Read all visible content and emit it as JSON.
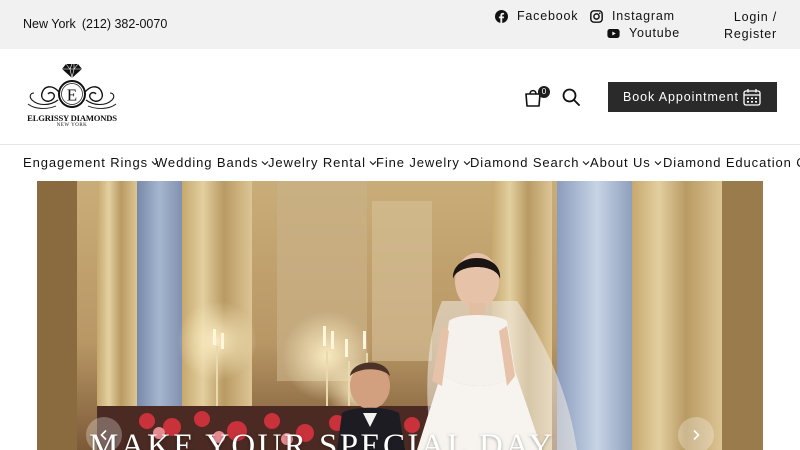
{
  "topbar": {
    "location": "New York",
    "phone": "(212) 382-0070",
    "social": {
      "facebook": {
        "label": "Facebook",
        "icon": "facebook-icon"
      },
      "instagram": {
        "label": "Instagram",
        "icon": "instagram-icon"
      },
      "youtube": {
        "label": "Youtube",
        "icon": "youtube-icon"
      }
    },
    "login": "Login /",
    "register": "Register"
  },
  "header": {
    "logo": {
      "monogram": "E",
      "name": "ELGRISSY DIAMONDS",
      "sub": "NEW YORK"
    },
    "cart_count": "0",
    "book_appointment": "Book Appointment"
  },
  "nav": {
    "items": [
      {
        "label": "Engagement Rings"
      },
      {
        "label": "Wedding Bands"
      },
      {
        "label": "Jewelry Rental"
      },
      {
        "label": "Fine Jewelry"
      },
      {
        "label": "Diamond Search"
      },
      {
        "label": "About Us"
      },
      {
        "label": "Diamond Education Cer"
      }
    ]
  },
  "hero": {
    "title": "MAKE YOUR SPECIAL DAY"
  },
  "colors": {
    "topbar_bg": "#f1f1f1",
    "button_bg": "#2a2a2a",
    "text": "#111111"
  }
}
